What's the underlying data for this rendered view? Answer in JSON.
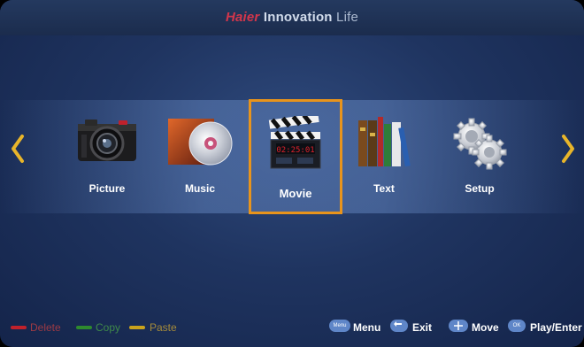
{
  "header": {
    "brand": "Haier",
    "title_main": "Innovation",
    "title_rest": "Life"
  },
  "menu_items": [
    {
      "label": "Picture",
      "icon": "camera-icon"
    },
    {
      "label": "Music",
      "icon": "cd-icon"
    },
    {
      "label": "Movie",
      "icon": "clapperboard-icon",
      "selected": true,
      "screen_text": "02:25:01"
    },
    {
      "label": "Text",
      "icon": "books-icon"
    },
    {
      "label": "Setup",
      "icon": "gears-icon"
    }
  ],
  "color_keys": [
    {
      "label": "Delete",
      "color": "#c0212b"
    },
    {
      "label": "Copy",
      "color": "#2e8a2e"
    },
    {
      "label": "Paste",
      "color": "#c9a21c"
    }
  ],
  "remote_keys": [
    {
      "key": "Menu",
      "label": "Menu"
    },
    {
      "key": "",
      "label": "Exit"
    },
    {
      "key": "",
      "label": "Move"
    },
    {
      "key": "OK",
      "label": "Play/Enter"
    }
  ],
  "colors": {
    "accent": "#e8941c",
    "arrow": "#e8b52a",
    "background": "#1f3460"
  }
}
